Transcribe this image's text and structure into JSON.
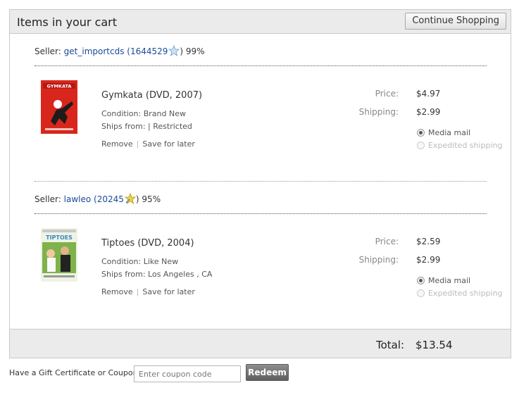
{
  "header": {
    "title": "Items in your cart",
    "continue_label": "Continue Shopping"
  },
  "sellers": [
    {
      "label": "Seller:",
      "name": "get_importcds",
      "rating_open": "(1644529",
      "rating_close": ")",
      "positive": "99%",
      "star_icon": "star-rating-icon",
      "item": {
        "title": "Gymkata (DVD, 2007)",
        "cover_text": "GYMKATA",
        "condition_label": "Condition:",
        "condition": "Brand New",
        "ships_label": "Ships from:",
        "ships_from": "| Restricted",
        "remove": "Remove",
        "save": "Save for later",
        "price_label": "Price:",
        "price": "$4.97",
        "shipping_label": "Shipping:",
        "shipping": "$2.99",
        "ship_options": [
          {
            "label": "Media mail",
            "checked": true,
            "disabled": false
          },
          {
            "label": "Expedited shipping",
            "checked": false,
            "disabled": true
          }
        ]
      }
    },
    {
      "label": "Seller:",
      "name": "lawleo",
      "rating_open": "(20245",
      "rating_close": ")",
      "positive": "95%",
      "star_icon": "star-rating-icon",
      "item": {
        "title": "Tiptoes (DVD, 2004)",
        "cover_text": "TIPTOES",
        "condition_label": "Condition:",
        "condition": "Like New",
        "ships_label": "Ships from:",
        "ships_from": "Los Angeles , CA",
        "remove": "Remove",
        "save": "Save for later",
        "price_label": "Price:",
        "price": "$2.59",
        "shipping_label": "Shipping:",
        "shipping": "$2.99",
        "ship_options": [
          {
            "label": "Media mail",
            "checked": true,
            "disabled": false
          },
          {
            "label": "Expedited shipping",
            "checked": false,
            "disabled": true
          }
        ]
      }
    }
  ],
  "total": {
    "label": "Total:",
    "value": "$13.54"
  },
  "coupon": {
    "label": "Have a Gift Certificate or Coupon?",
    "placeholder": "Enter coupon code",
    "redeem": "Redeem"
  },
  "colors": {
    "link": "#1a4a9a",
    "header_bg": "#ebebeb",
    "gymkata_cover": "#d8261c",
    "redeem_bg": "#6e6e6e"
  }
}
